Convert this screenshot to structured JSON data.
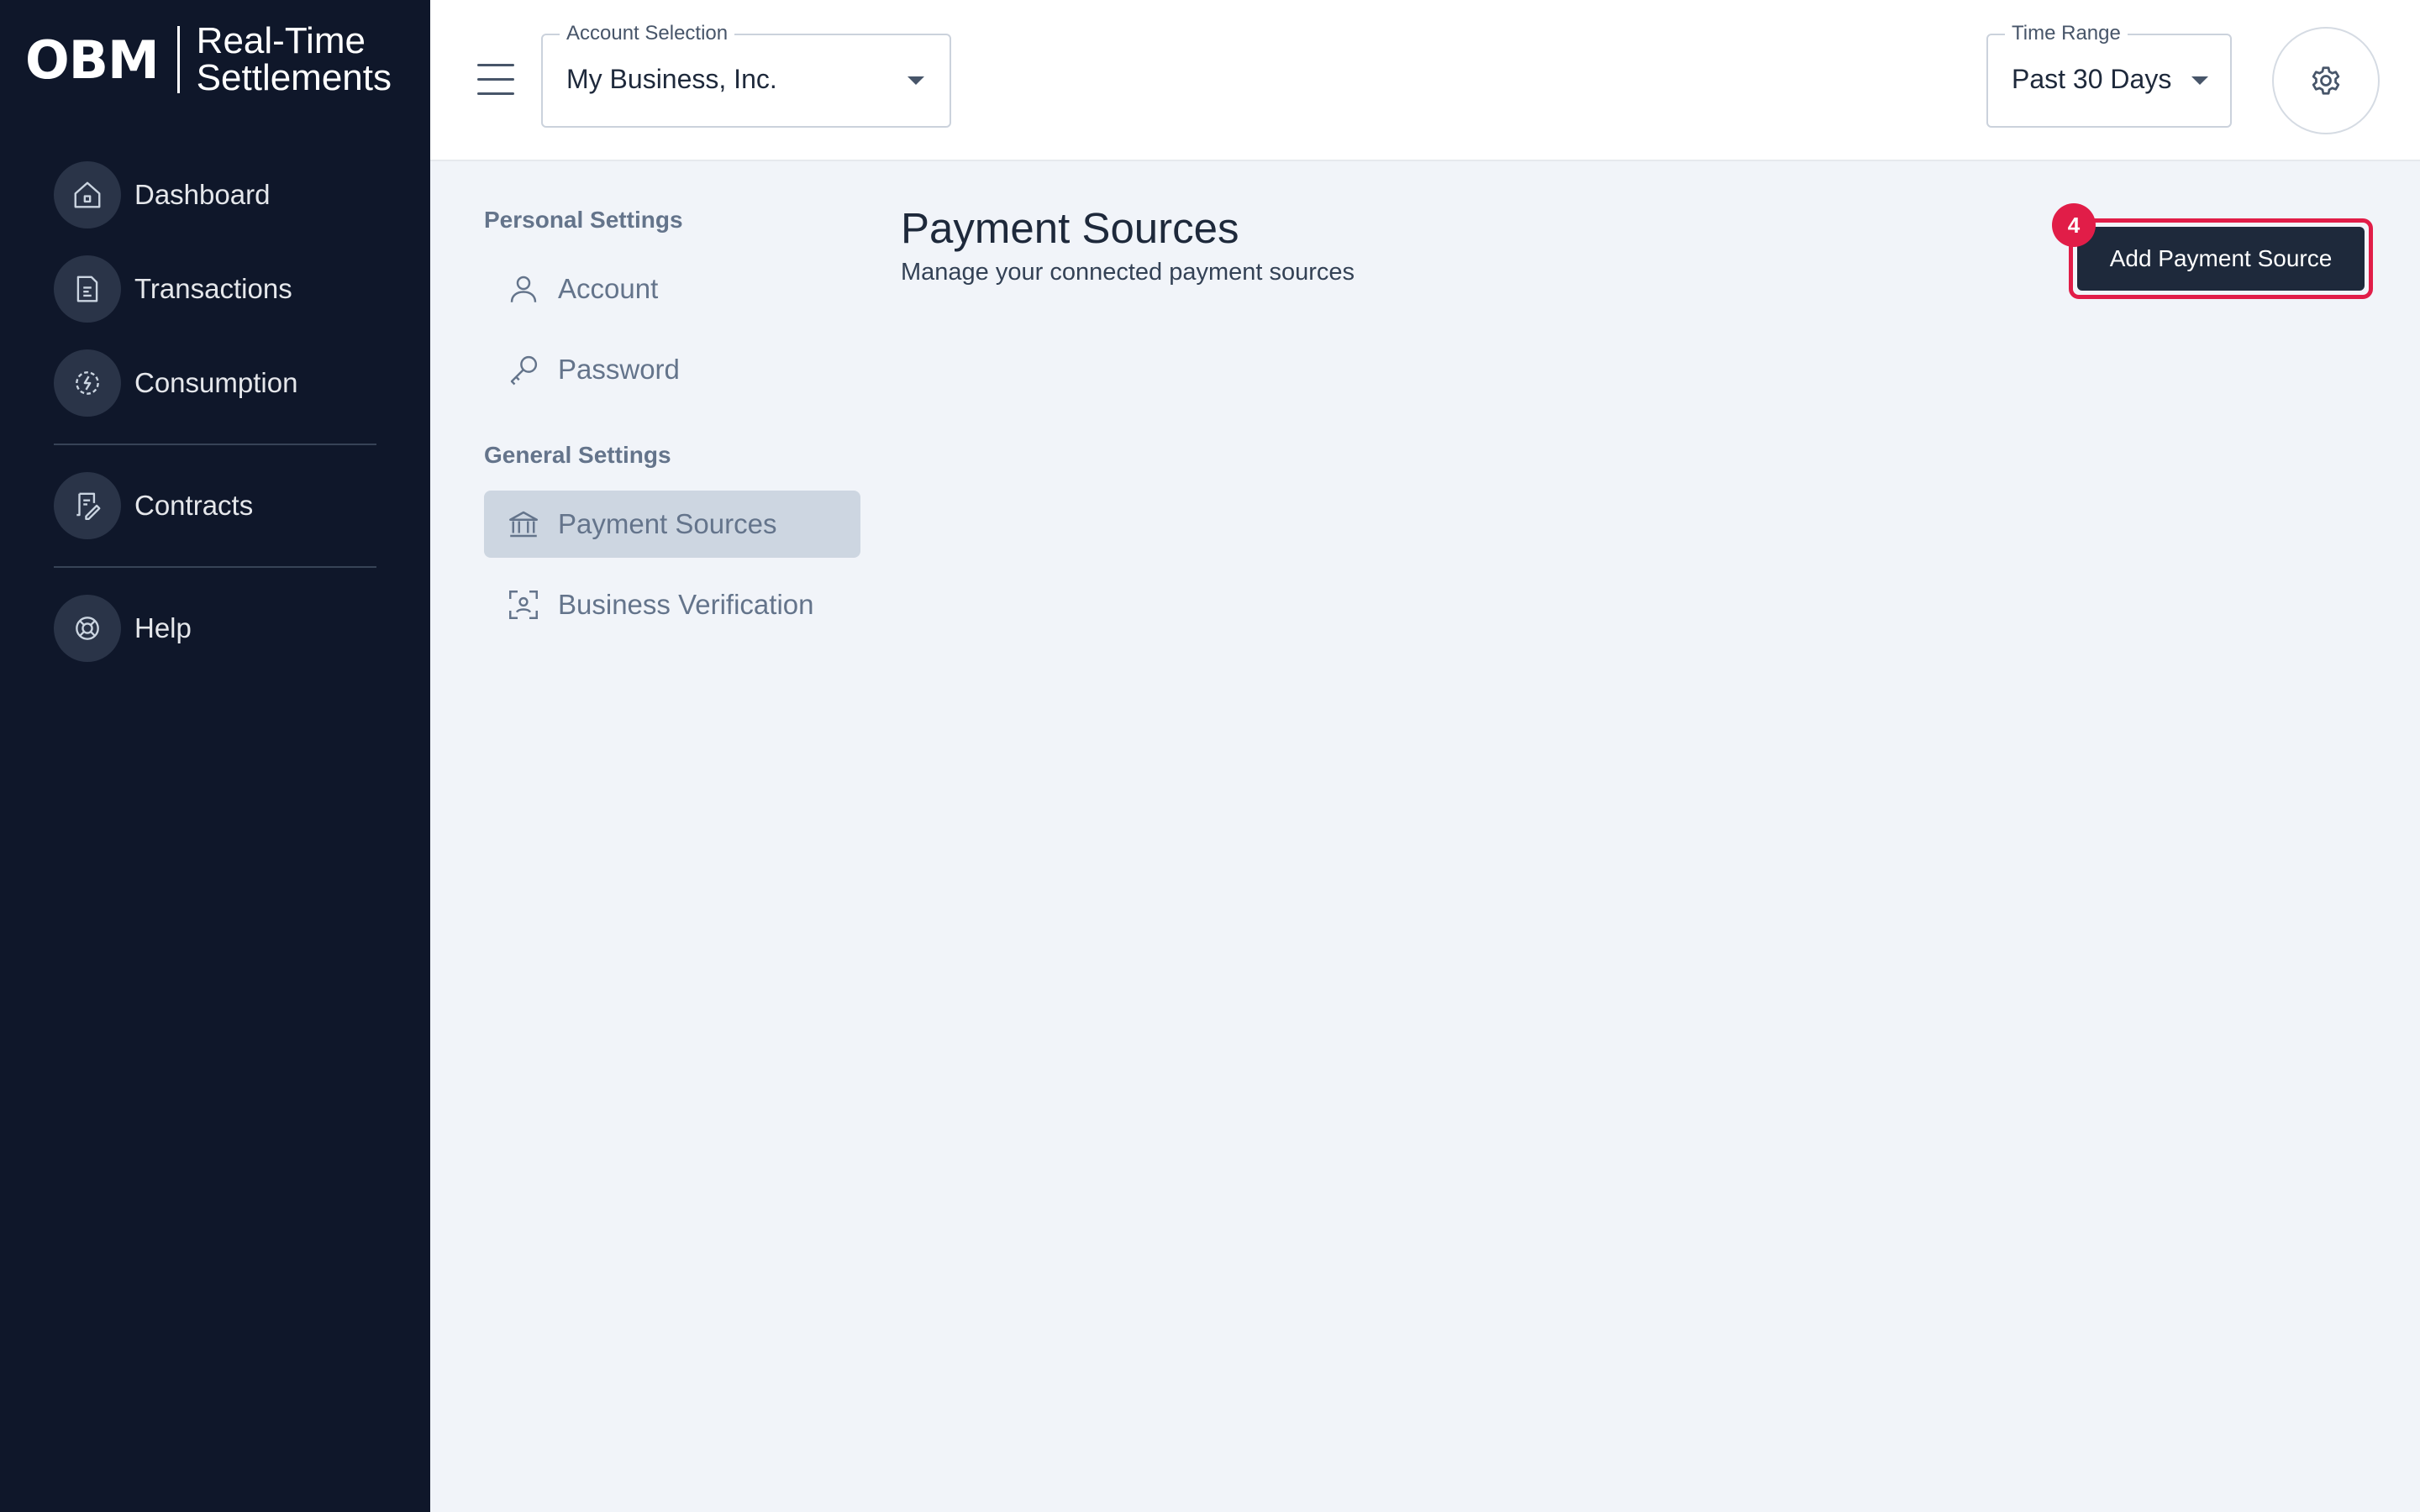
{
  "logo": {
    "mark": "OBM",
    "line1": "Real-Time",
    "line2": "Settlements"
  },
  "sidebar": {
    "items": [
      {
        "label": "Dashboard",
        "icon": "home-icon"
      },
      {
        "label": "Transactions",
        "icon": "document-icon"
      },
      {
        "label": "Consumption",
        "icon": "bolt-circle-icon"
      },
      {
        "label": "Contracts",
        "icon": "contract-edit-icon"
      },
      {
        "label": "Help",
        "icon": "lifebuoy-icon"
      }
    ]
  },
  "topbar": {
    "account": {
      "legend": "Account Selection",
      "value": "My Business, Inc."
    },
    "time_range": {
      "legend": "Time Range",
      "value": "Past 30 Days"
    },
    "settings_icon": "gear-icon",
    "menu_icon": "hamburger-icon"
  },
  "settings_nav": {
    "personal_heading": "Personal Settings",
    "personal_items": [
      {
        "label": "Account",
        "icon": "user-icon"
      },
      {
        "label": "Password",
        "icon": "key-icon"
      }
    ],
    "general_heading": "General Settings",
    "general_items": [
      {
        "label": "Payment Sources",
        "icon": "bank-icon",
        "active": true
      },
      {
        "label": "Business Verification",
        "icon": "face-scan-icon"
      }
    ]
  },
  "main": {
    "title": "Payment Sources",
    "subtitle": "Manage your connected payment sources",
    "add_button": "Add Payment Source",
    "badge": "4"
  },
  "colors": {
    "sidebar_bg": "#0f172a",
    "content_bg": "#f1f4f9",
    "primary_button": "#1e293b",
    "highlight": "#e11d48"
  }
}
